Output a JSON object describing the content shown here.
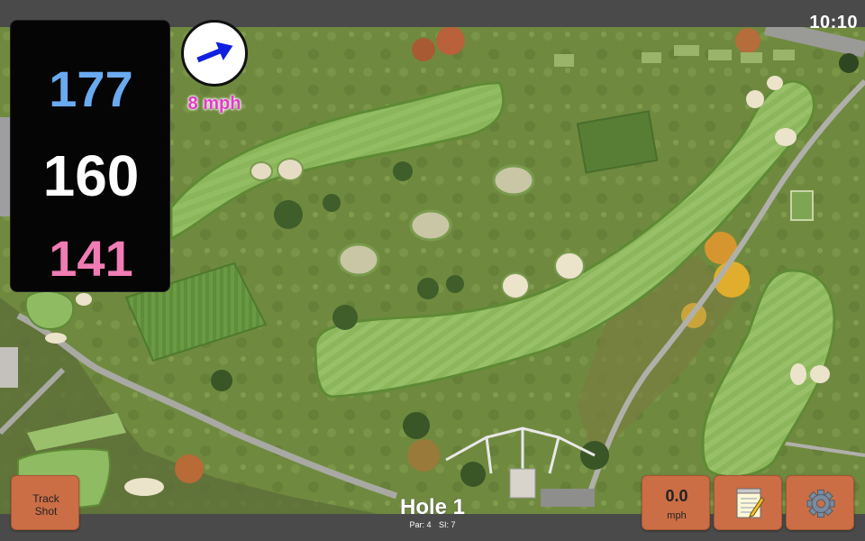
{
  "status_bar": {
    "time": "10:10"
  },
  "yardage": {
    "back": "177",
    "center": "160",
    "front": "141",
    "colors": {
      "back": "#6aaaf0",
      "center": "#ffffff",
      "front": "#f07cb4"
    }
  },
  "wind": {
    "speed_label": "8 mph",
    "icon": "wind-arrow-icon",
    "arrow_color": "#1020e0"
  },
  "hole": {
    "title": "Hole 1",
    "par_label": "Par: 4",
    "si_label": "SI: 7"
  },
  "buttons": {
    "track_shot": {
      "line1": "Track",
      "line2": "Shot"
    },
    "speed": {
      "value": "0.0",
      "unit": "mph"
    },
    "notes": {
      "icon": "notepad-icon"
    },
    "settings": {
      "icon": "gear-icon"
    }
  },
  "colors": {
    "button": "#cb6e45",
    "bar": "#4a4a4a"
  }
}
